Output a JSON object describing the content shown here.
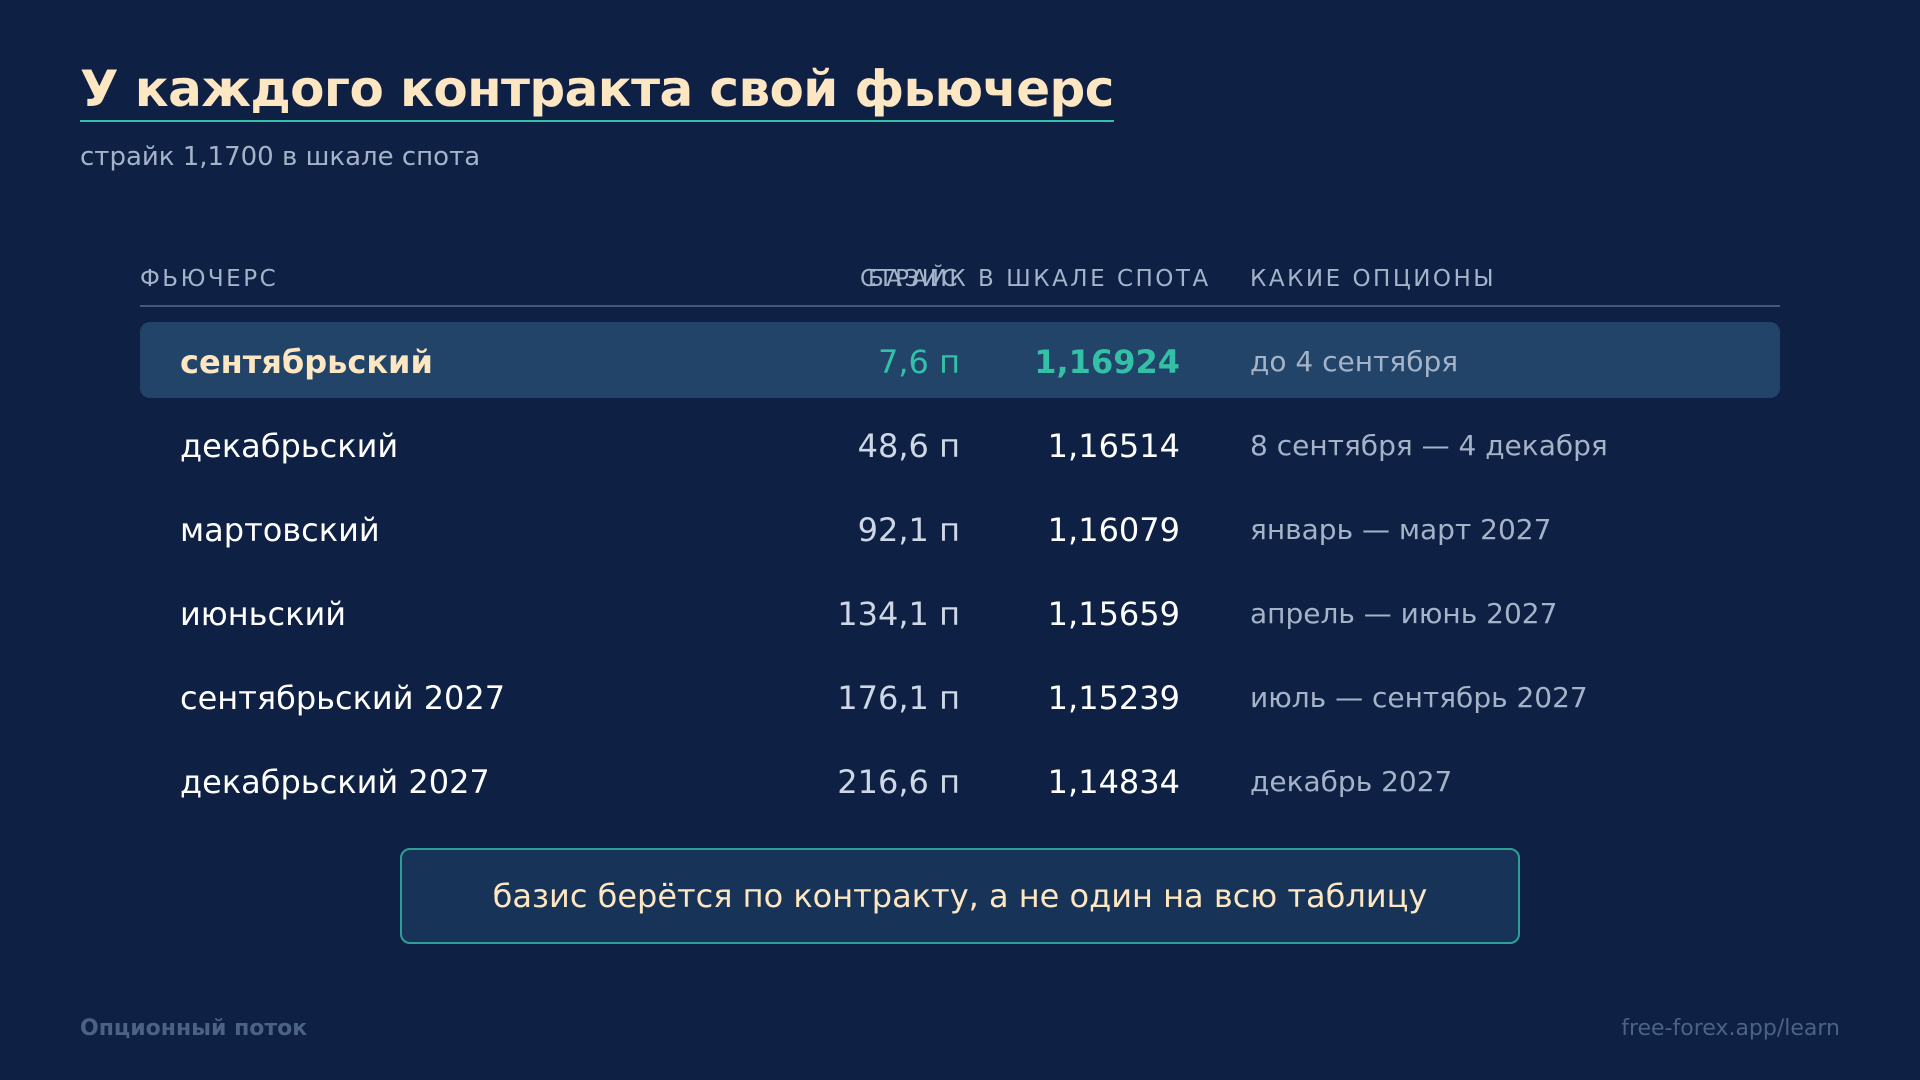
{
  "header": {
    "title": "У каждого контракта свой фьючерс",
    "subtitle": "страйк 1,1700 в шкале спота"
  },
  "table": {
    "columns": {
      "name": "ФЬЮЧЕРС",
      "basis": "БАЗИС",
      "strike": "СТРАЙК В ШКАЛЕ СПОТА",
      "options": "КАКИЕ ОПЦИОНЫ"
    },
    "rows": [
      {
        "name": "сентябрьский",
        "basis": "7,6 п",
        "strike": "1,16924",
        "options": "до 4 сентября",
        "highlighted": true
      },
      {
        "name": "декабрьский",
        "basis": "48,6 п",
        "strike": "1,16514",
        "options": "8 сентября — 4 декабря",
        "highlighted": false
      },
      {
        "name": "мартовский",
        "basis": "92,1 п",
        "strike": "1,16079",
        "options": "январь — март 2027",
        "highlighted": false
      },
      {
        "name": "июньский",
        "basis": "134,1 п",
        "strike": "1,15659",
        "options": "апрель — июнь 2027",
        "highlighted": false
      },
      {
        "name": "сентябрьский 2027",
        "basis": "176,1 п",
        "strike": "1,15239",
        "options": "июль — сентябрь 2027",
        "highlighted": false
      },
      {
        "name": "декабрьский 2027",
        "basis": "216,6 п",
        "strike": "1,14834",
        "options": "декабрь 2027",
        "highlighted": false
      }
    ]
  },
  "note": {
    "text": "базис берётся по контракту, а не один на всю таблицу"
  },
  "footer": {
    "brand": "Опционный поток",
    "link": "free-forex.app/learn"
  },
  "colors": {
    "background": "#0e2043",
    "accent_teal": "#33c0a6",
    "title_cream": "#fde6c2",
    "highlight_row": "#214468"
  }
}
